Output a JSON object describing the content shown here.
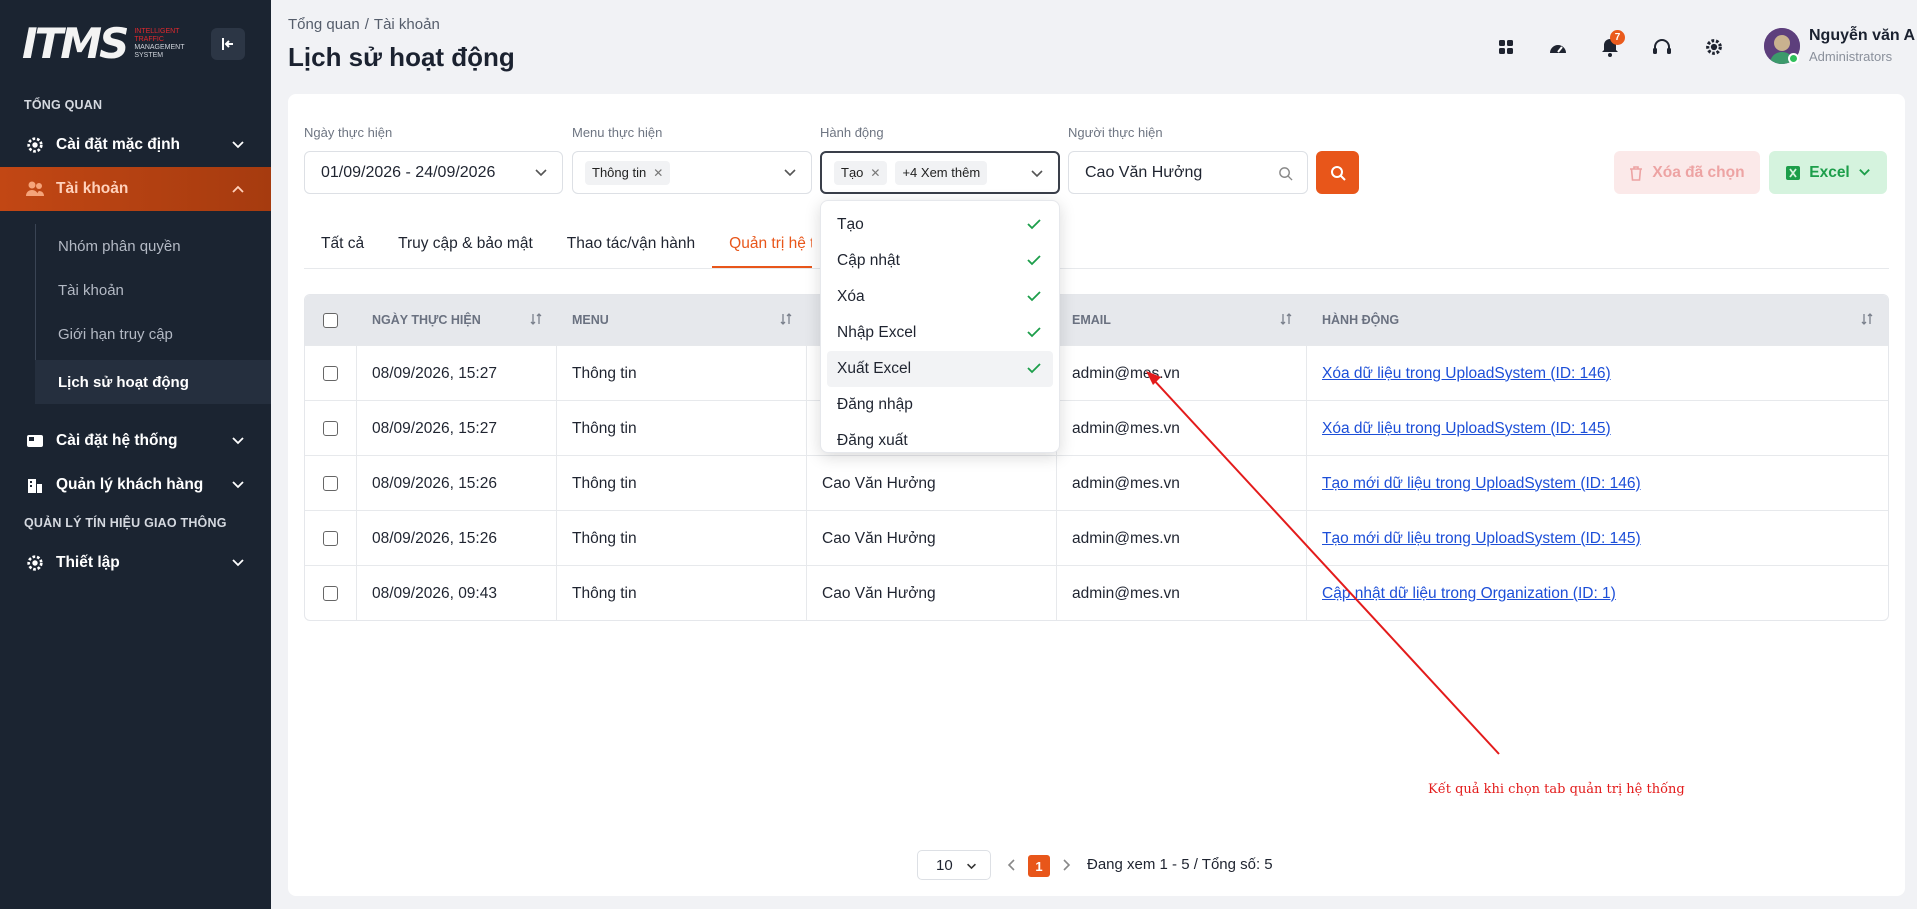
{
  "logo": {
    "main": "ITMS",
    "sub_line1": "INTELLIGENT",
    "sub_line2": "TRAFFIC",
    "sub_line3": "MANAGEMENT",
    "sub_line4": "SYSTEM"
  },
  "sidebar": {
    "section1": "TỔNG QUAN",
    "items": [
      {
        "label": "Cài đặt mặc định",
        "icon": "gear-icon"
      },
      {
        "label": "Tài khoản",
        "icon": "users-icon"
      },
      {
        "label": "Cài đặt hệ thống",
        "icon": "card-icon"
      },
      {
        "label": "Quản lý khách hàng",
        "icon": "building-icon"
      },
      {
        "label": "Thiết lập",
        "icon": "gear-icon"
      }
    ],
    "sub_items": [
      "Nhóm phân quyền",
      "Tài khoản",
      "Giới hạn truy cập",
      "Lịch sử hoạt động"
    ],
    "section2": "QUẢN LÝ TÍN HIỆU GIAO THÔNG"
  },
  "header": {
    "breadcrumb": [
      "Tổng quan",
      "Tài khoản"
    ],
    "breadcrumb_sep": "/",
    "title": "Lịch sử hoạt động",
    "notif_count": "7",
    "user_name": "Nguyễn văn A",
    "user_role": "Administrators"
  },
  "filters": {
    "date_label": "Ngày thực hiện",
    "date_value": "01/09/2026 - 24/09/2026",
    "menu_label": "Menu thực hiện",
    "menu_tag": "Thông tin",
    "action_label": "Hành động",
    "action_tag": "Tạo",
    "action_more": "+4 Xem thêm",
    "user_label": "Người thực hiện",
    "user_value": "Cao Văn Hưởng",
    "delete_label": "Xóa đã chọn",
    "excel_label": "Excel"
  },
  "tabs": [
    "Tất cả",
    "Truy cập & bảo mật",
    "Thao tác/vận hành",
    "Quản trị hệ t"
  ],
  "table": {
    "headers": [
      "NGÀY THỰC HIỆN",
      "MENU",
      "",
      "EMAIL",
      "HÀNH ĐỘNG"
    ],
    "rows": [
      {
        "date": "08/09/2026, 15:27",
        "menu": "Thông tin",
        "user": "",
        "email": "admin@mes.vn",
        "action": "Xóa dữ liệu trong UploadSystem (ID: 146)"
      },
      {
        "date": "08/09/2026, 15:27",
        "menu": "Thông tin",
        "user": "",
        "email": "admin@mes.vn",
        "action": "Xóa dữ liệu trong UploadSystem (ID: 145)"
      },
      {
        "date": "08/09/2026, 15:26",
        "menu": "Thông tin",
        "user": "Cao Văn Hưởng",
        "email": "admin@mes.vn",
        "action": "Tạo mới dữ liệu trong UploadSystem (ID: 146)"
      },
      {
        "date": "08/09/2026, 15:26",
        "menu": "Thông tin",
        "user": "Cao Văn Hưởng",
        "email": "admin@mes.vn",
        "action": "Tạo mới dữ liệu trong UploadSystem (ID: 145)"
      },
      {
        "date": "08/09/2026, 09:43",
        "menu": "Thông tin",
        "user": "Cao Văn Hưởng",
        "email": "admin@mes.vn",
        "action": "Cập nhật dữ liệu trong Organization (ID: 1)"
      }
    ]
  },
  "dropdown": {
    "options": [
      {
        "label": "Tạo",
        "checked": true
      },
      {
        "label": "Cập nhật",
        "checked": true
      },
      {
        "label": "Xóa",
        "checked": true
      },
      {
        "label": "Nhập Excel",
        "checked": true
      },
      {
        "label": "Xuất Excel",
        "checked": true
      },
      {
        "label": "Đăng nhập",
        "checked": false
      },
      {
        "label": "Đăng xuất",
        "checked": false
      }
    ]
  },
  "pagination": {
    "page_size": "10",
    "current_page": "1",
    "info": "Đang xem 1 - 5 / Tổng số: 5"
  },
  "annotation": "Kết quả khi chọn tab quản trị hệ thống",
  "colors": {
    "accent": "#e8561a",
    "sidebar_bg": "#1b2431",
    "link": "#1d4fd8",
    "annotation": "#e31b1b"
  }
}
